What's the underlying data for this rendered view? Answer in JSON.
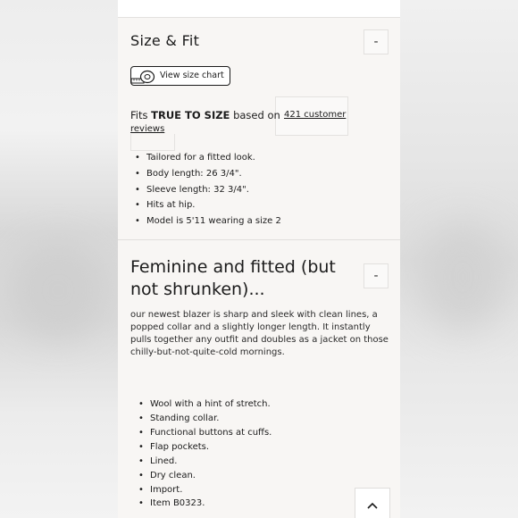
{
  "size_fit": {
    "title": "Size & Fit",
    "toggle_symbol": "-",
    "size_chart_label": "View size chart",
    "fits_prefix": "Fits ",
    "fits_value": "TRUE TO SIZE",
    "fits_suffix": " based on",
    "reviews_line1": "421 customer",
    "reviews_line2": "reviews",
    "details": [
      "Tailored for a fitted look.",
      "Body length: 26 3/4\".",
      "Sleeve length: 32 3/4\".",
      "Hits at hip.",
      "Model is 5'11 wearing a size 2"
    ]
  },
  "description": {
    "title_line1": "Feminine and fitted (but",
    "title_line2": "not shrunken)...",
    "toggle_symbol": "-",
    "body": "our newest blazer is sharp and sleek with clean lines, a popped collar and a slightly longer length. It instantly pulls together any outfit and doubles as a jacket on those chilly-but-not-quite-cold mornings.",
    "features": [
      "Wool with a hint of stretch.",
      "Standing collar.",
      "Functional buttons at cuffs.",
      "Flap pockets.",
      "Lined.",
      "Dry clean.",
      "Import.",
      "Item B0323."
    ]
  },
  "icons": {
    "size_chart": "measuring-tape-icon",
    "scroll_top": "chevron-up-icon"
  }
}
